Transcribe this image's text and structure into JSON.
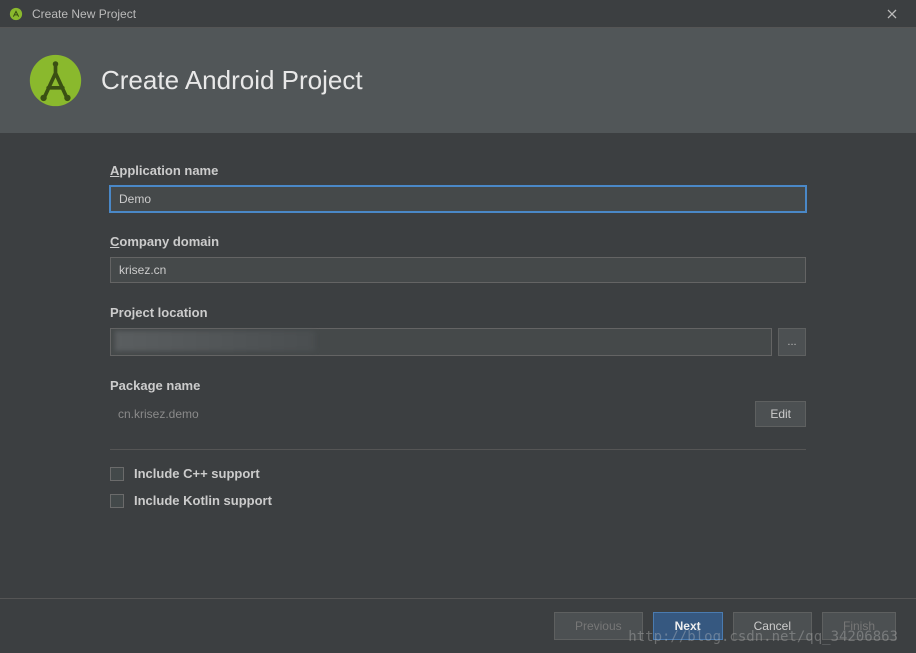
{
  "window": {
    "title": "Create New Project"
  },
  "header": {
    "title": "Create Android Project"
  },
  "fields": {
    "app_name_label": "pplication name",
    "app_name_prefix": "A",
    "app_name_value": "Demo",
    "company_domain_label": "ompany domain",
    "company_domain_prefix": "C",
    "company_domain_value": "krisez.cn",
    "project_location_label": "Project location",
    "browse_label": "...",
    "package_name_label": "Package name",
    "package_name_value": "cn.krisez.demo",
    "edit_label": "Edit",
    "include_cpp_label": "Include C++ support",
    "include_kotlin_label": "Include Kotlin support"
  },
  "footer": {
    "previous": "Previous",
    "next": "Next",
    "cancel": "Cancel",
    "finish": "Finish"
  },
  "watermark": "http://blog.csdn.net/qq_34206863"
}
